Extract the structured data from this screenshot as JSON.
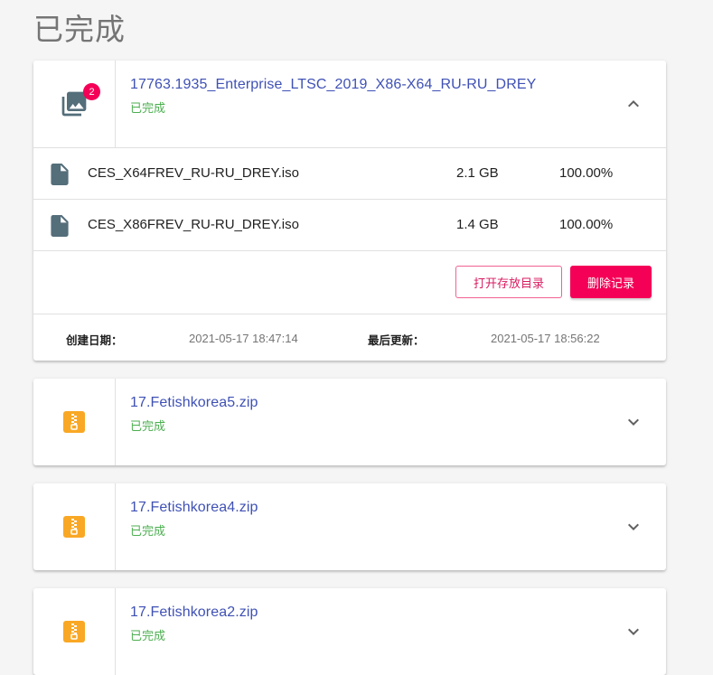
{
  "page": {
    "title": "已完成"
  },
  "colors": {
    "accent": "#f50057",
    "link": "#3f51b5",
    "success": "#4caf50",
    "zip": "#f9a825",
    "file": "#546e7a"
  },
  "tasks": [
    {
      "name": "17763.1935_Enterprise_LTSC_2019_X86-X64_RU-RU_DREY",
      "status": "已完成",
      "icon": "photo-library-icon",
      "badge": "2",
      "expanded": true,
      "files": [
        {
          "name": "CES_X64FREV_RU-RU_DREY.iso",
          "size": "2.1 GB",
          "progress": "100.00%"
        },
        {
          "name": "CES_X86FREV_RU-RU_DREY.iso",
          "size": "1.4 GB",
          "progress": "100.00%"
        }
      ],
      "actions": {
        "open_folder": "打开存放目录",
        "delete_record": "删除记录"
      },
      "meta": {
        "created_label": "创建日期：",
        "created_value": "2021-05-17 18:47:14",
        "updated_label": "最后更新：",
        "updated_value": "2021-05-17 18:56:22"
      }
    },
    {
      "name": "17.Fetishkorea5.zip",
      "status": "已完成",
      "icon": "zip-file-icon",
      "expanded": false
    },
    {
      "name": "17.Fetishkorea4.zip",
      "status": "已完成",
      "icon": "zip-file-icon",
      "expanded": false
    },
    {
      "name": "17.Fetishkorea2.zip",
      "status": "已完成",
      "icon": "zip-file-icon",
      "expanded": false
    }
  ]
}
